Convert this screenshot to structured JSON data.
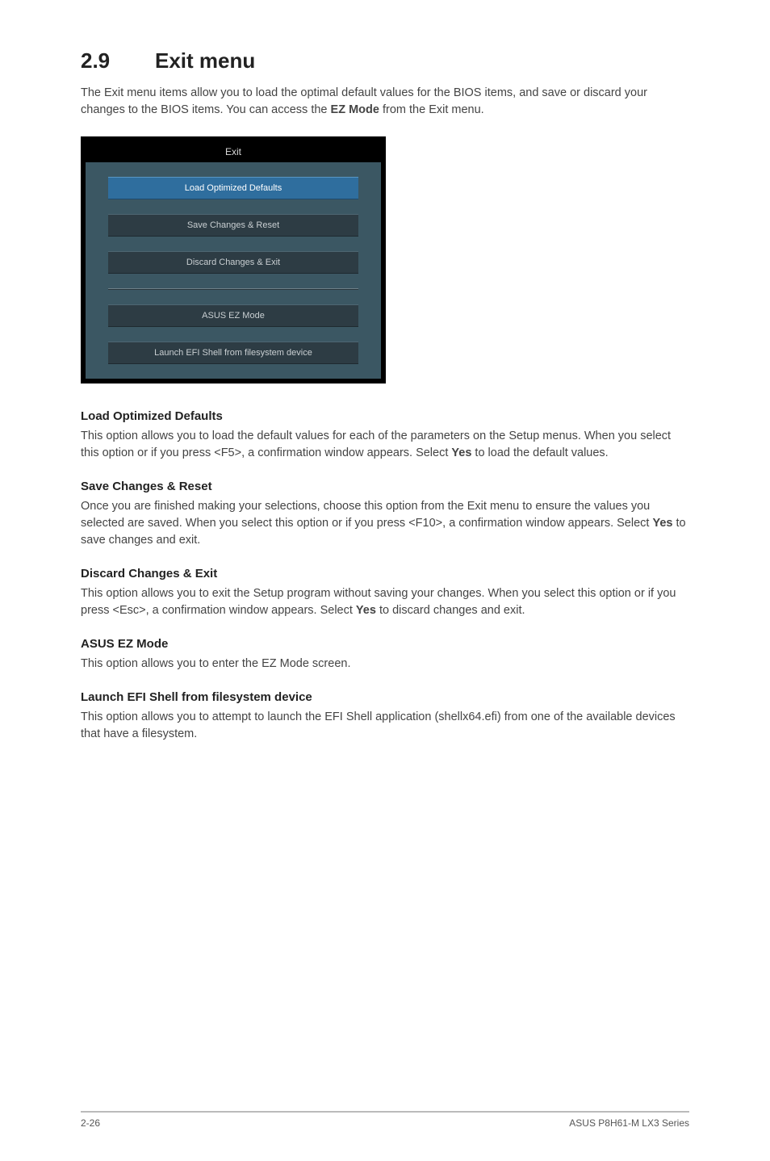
{
  "section": {
    "number": "2.9",
    "title": "Exit menu"
  },
  "intro_pre": "The Exit menu items allow you to load the optimal default values for the BIOS items, and save or discard your changes to the BIOS items. You can access the ",
  "intro_bold": "EZ Mode",
  "intro_post": " from the Exit menu.",
  "bios": {
    "title": "Exit",
    "buttons": {
      "load_defaults": "Load Optimized Defaults",
      "save_reset": "Save Changes & Reset",
      "discard_exit": "Discard Changes & Exit",
      "ez_mode": "ASUS EZ Mode",
      "efi_shell": "Launch EFI Shell from filesystem device"
    }
  },
  "sections": {
    "load_defaults": {
      "heading": "Load Optimized Defaults",
      "p1": "This option allows you to load the default values for each of the parameters on the Setup menus. When you select this option or if you press <F5>, a confirmation window appears. Select ",
      "p1_bold": "Yes",
      "p1_after": " to load the default values."
    },
    "save_reset": {
      "heading": "Save Changes & Reset",
      "p1": "Once you are finished making your selections, choose this option from the Exit menu to ensure the values you selected are saved. When you select this option or if you press <F10>, a confirmation window appears. Select ",
      "p1_bold": "Yes",
      "p1_after": " to save changes and exit."
    },
    "discard_exit": {
      "heading": "Discard Changes & Exit",
      "p1": "This option allows you to exit the Setup program without saving your changes. When you select this option or if you press <Esc>, a confirmation window appears. Select ",
      "p1_bold": "Yes",
      "p1_after": " to discard changes and exit."
    },
    "ez_mode": {
      "heading": "ASUS EZ Mode",
      "p1": "This option allows you to enter the EZ Mode screen."
    },
    "efi_shell": {
      "heading": "Launch EFI Shell from filesystem device",
      "p1": "This option allows you to attempt to launch the EFI Shell application (shellx64.efi) from one of the available devices that have a filesystem."
    }
  },
  "footer": {
    "page": "2-26",
    "product": "ASUS P8H61-M LX3 Series"
  }
}
